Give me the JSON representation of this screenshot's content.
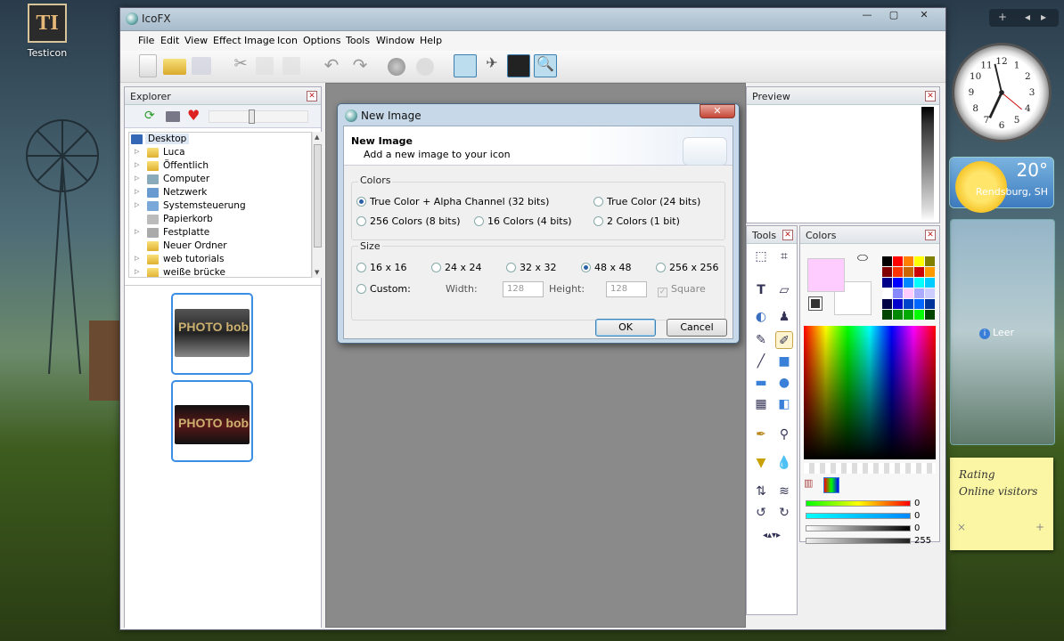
{
  "desktop": {
    "icon_label": "Testicon",
    "icon_glyph": "TI"
  },
  "sidebar": {
    "plus": "+",
    "weather": {
      "temp": "20°",
      "city": "Rendsburg, SH"
    },
    "slideshow": {
      "label": "Leer"
    },
    "note": {
      "line1": "Rating",
      "line2": "Online visitors",
      "close": "×",
      "add": "+"
    }
  },
  "window": {
    "title": "IcoFX",
    "controls": {
      "minimize": "—",
      "maximize": "▢",
      "close": "✕"
    },
    "menu": [
      "File",
      "Edit",
      "View",
      "Effect",
      "Image",
      "Icon",
      "Options",
      "Tools",
      "Window",
      "Help"
    ]
  },
  "explorer": {
    "title": "Explorer",
    "tree": [
      {
        "label": "Desktop",
        "selected": true
      },
      {
        "label": "Luca"
      },
      {
        "label": "Öffentlich"
      },
      {
        "label": "Computer"
      },
      {
        "label": "Netzwerk"
      },
      {
        "label": "Systemsteuerung"
      },
      {
        "label": "Papierkorb"
      },
      {
        "label": "Festplatte"
      },
      {
        "label": "Neuer Ordner"
      },
      {
        "label": "web tutorials"
      },
      {
        "label": "weiße brücke"
      }
    ],
    "thumbs": [
      {
        "text": "PHOTO bob"
      },
      {
        "text": "PHOTO bob"
      }
    ]
  },
  "dialog": {
    "title": "New Image",
    "header_title": "New Image",
    "header_sub": "Add a new image to your icon",
    "colors_label": "Colors",
    "color_options": [
      "True Color + Alpha Channel (32 bits)",
      "True Color (24 bits)",
      "256 Colors (8 bits)",
      "16 Colors (4 bits)",
      "2 Colors (1 bit)"
    ],
    "size_label": "Size",
    "size_options": [
      "16 x 16",
      "24 x 24",
      "32 x 32",
      "48 x 48",
      "256 x 256"
    ],
    "custom_label": "Custom:",
    "width_label": "Width:",
    "width_value": "128",
    "height_label": "Height:",
    "height_value": "128",
    "square_label": "Square",
    "ok": "OK",
    "cancel": "Cancel"
  },
  "preview": {
    "title": "Preview"
  },
  "tools": {
    "title": "Tools"
  },
  "colors": {
    "title": "Colors",
    "values": [
      "0",
      "0",
      "0",
      "255"
    ],
    "primary_color": "#ffccff",
    "secondary_color": "#ffffff"
  }
}
